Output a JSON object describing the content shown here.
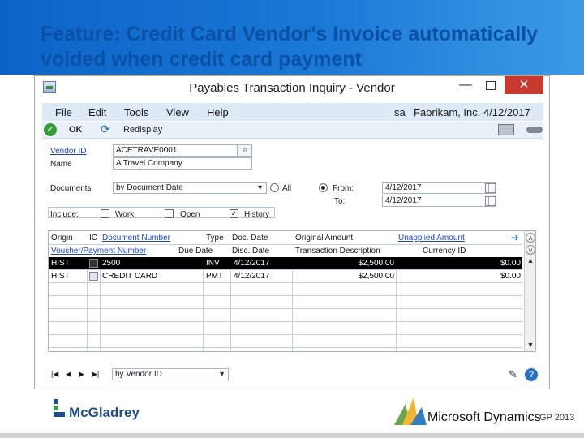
{
  "slide": {
    "title": "Feature: Credit Card Vendor's Invoice automatically voided when credit card payment"
  },
  "window": {
    "title": "Payables Transaction Inquiry - Vendor",
    "close_glyph": "✕",
    "minimize_glyph": "—"
  },
  "menu": {
    "items": [
      "File",
      "Edit",
      "Tools",
      "View",
      "Help"
    ],
    "user": "sa",
    "company_date": "Fabrikam, Inc.  4/12/2017"
  },
  "toolbar": {
    "ok_label": "OK",
    "redisplay_label": "Redisplay"
  },
  "form": {
    "vendor_id_label": "Vendor ID",
    "vendor_id_value": "ACETRAVE0001",
    "name_label": "Name",
    "name_value": "A Travel Company",
    "documents_label": "Documents",
    "documents_value": "by Document Date",
    "all_label": "All",
    "from_label": "From:",
    "from_value": "4/12/2017",
    "to_label": "To:",
    "to_value": "4/12/2017",
    "include_label": "Include:",
    "work_label": "Work",
    "open_label": "Open",
    "history_label": "History",
    "work_checked": false,
    "open_checked": false,
    "history_checked": true,
    "range_selected": "From"
  },
  "grid": {
    "headers_row1": [
      "Origin",
      "IC",
      "Document Number",
      "Type",
      "Doc. Date",
      "Original Amount",
      "Unapplied Amount"
    ],
    "headers_row2": [
      "Voucher/Payment Number",
      "Due Date",
      "Disc. Date",
      "Transaction Description",
      "Currency ID"
    ],
    "rows": [
      {
        "origin": "HIST",
        "doc_number": "2500",
        "type": "INV",
        "doc_date": "4/12/2017",
        "amount": "$2,500.00",
        "unapplied": "$0.00",
        "selected": true
      },
      {
        "origin": "HIST",
        "doc_number": "CREDIT CARD",
        "type": "PMT",
        "doc_date": "4/12/2017",
        "amount": "$2,500.00",
        "unapplied": "$0.00",
        "selected": false
      }
    ]
  },
  "footer": {
    "sort_value": "by Vendor ID"
  },
  "branding": {
    "mcgladrey": "McGladrey",
    "microsoft": "Microsoft Dynamics",
    "gp_version": "GP 2013"
  },
  "colors": {
    "banner": "#1b79d6",
    "menubar": "#dee9f6",
    "close_button": "#c83a2f",
    "link": "#1a45c8"
  }
}
